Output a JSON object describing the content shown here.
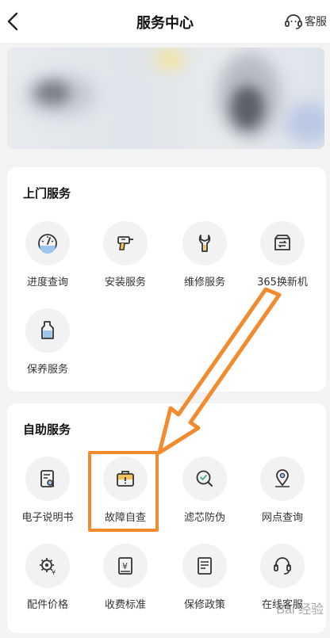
{
  "header": {
    "title": "服务中心",
    "cs_label": "客服"
  },
  "door_service": {
    "title": "上门服务",
    "items": [
      {
        "label": "进度查询",
        "icon": "progress-gauge-icon"
      },
      {
        "label": "安装服务",
        "icon": "drill-icon"
      },
      {
        "label": "维修服务",
        "icon": "wrench-icon"
      },
      {
        "label": "365换新机",
        "icon": "box-exchange-icon"
      },
      {
        "label": "保养服务",
        "icon": "bottle-icon"
      }
    ]
  },
  "self_service": {
    "title": "自助服务",
    "items": [
      {
        "label": "电子说明书",
        "icon": "manual-search-icon"
      },
      {
        "label": "故障自查",
        "icon": "toolbox-warning-icon"
      },
      {
        "label": "滤芯防伪",
        "icon": "magnifier-check-icon"
      },
      {
        "label": "网点查询",
        "icon": "location-pin-icon"
      },
      {
        "label": "配件价格",
        "icon": "gear-yen-icon"
      },
      {
        "label": "收费标准",
        "icon": "yen-document-icon"
      },
      {
        "label": "保修政策",
        "icon": "policy-document-icon"
      },
      {
        "label": "在线客服",
        "icon": "headset-icon"
      }
    ]
  },
  "accent_color": "#f28a2e",
  "watermark": "Bai 经验"
}
